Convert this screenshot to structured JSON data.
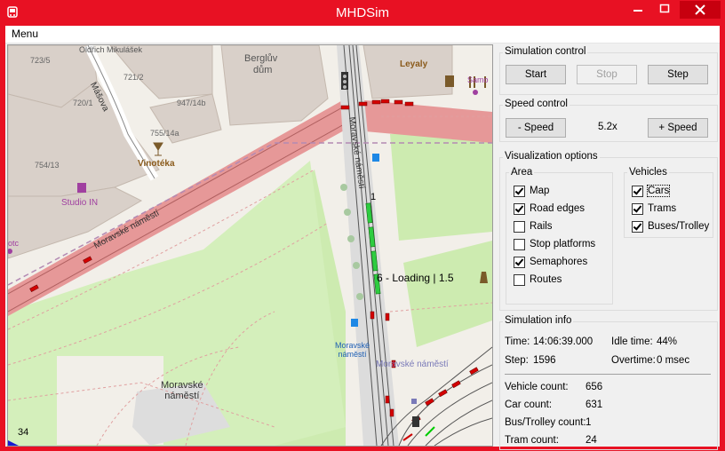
{
  "window": {
    "title": "MHDSim"
  },
  "menu": {
    "label": "Menu"
  },
  "simulation_control": {
    "title": "Simulation control",
    "start": "Start",
    "stop": "Stop",
    "step": "Step"
  },
  "speed_control": {
    "title": "Speed control",
    "minus": "- Speed",
    "value": "5.2x",
    "plus": "+ Speed"
  },
  "visualization": {
    "title": "Visualization options",
    "area_title": "Area",
    "area": [
      {
        "label": "Map",
        "checked": true
      },
      {
        "label": "Road edges",
        "checked": true
      },
      {
        "label": "Rails",
        "checked": false
      },
      {
        "label": "Stop platforms",
        "checked": false
      },
      {
        "label": "Semaphores",
        "checked": true
      },
      {
        "label": "Routes",
        "checked": false
      }
    ],
    "vehicles_title": "Vehicles",
    "vehicles": [
      {
        "label": "Cars",
        "checked": true
      },
      {
        "label": "Trams",
        "checked": true
      },
      {
        "label": "Buses/Trolley",
        "checked": true
      }
    ]
  },
  "info": {
    "title": "Simulation info",
    "time_label": "Time:",
    "time_value": "14:06:39.000",
    "idle_label": "Idle time:",
    "idle_value": "44%",
    "step_label": "Step:",
    "step_value": "1596",
    "overtime_label": "Overtime:",
    "overtime_value": "0 msec",
    "vehicle_count_label": "Vehicle count:",
    "vehicle_count": "656",
    "car_count_label": "Car count:",
    "car_count": "631",
    "bus_count_label": "Bus/Trolley count:",
    "bus_count": "1",
    "tram_count_label": "Tram count:",
    "tram_count": "24"
  },
  "map": {
    "labels": {
      "street_mikulasek": "Oldřich Mikulášek",
      "masova": "Mášova",
      "house_723": "723/5",
      "house_721": "721/2",
      "house_720": "720/1",
      "house_947": "947/14b",
      "house_755": "755/14a",
      "house_754": "754/13",
      "berglav_line1": "Berglův",
      "berglav_line2": "dům",
      "leyaly": "Leyaly",
      "samo": "Samo",
      "vinoteka": "Vinotéka",
      "studio_in": "Studio IN",
      "otc": "otc",
      "moravske_namesti_street": "Moravské náměstí",
      "moravske_namesti_vertical": "Moravské náměstí",
      "stop_line1": "Moravské",
      "stop_line2": "náměstí",
      "stop_lower": "Moravské náměstí",
      "square_line1": "Moravské",
      "square_line2": "náměstí",
      "loading": "6 - Loading | 1.5",
      "marker_one": "1",
      "zoom": "34"
    }
  }
}
